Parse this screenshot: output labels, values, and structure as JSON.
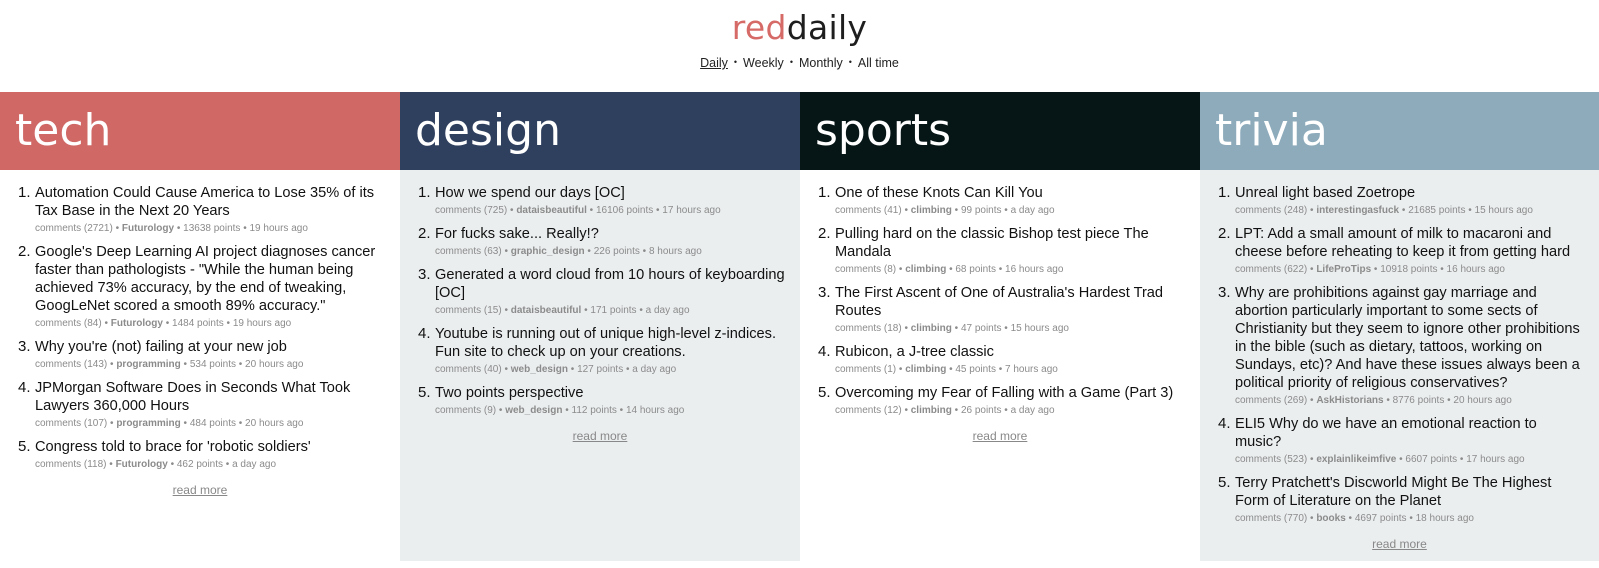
{
  "logo": {
    "part1": "red",
    "part2": "daily"
  },
  "periods": [
    {
      "label": "Daily",
      "active": true
    },
    {
      "label": "Weekly",
      "active": false
    },
    {
      "label": "Monthly",
      "active": false
    },
    {
      "label": "All time",
      "active": false
    }
  ],
  "separator": "•",
  "read_more": "read more",
  "columns": [
    {
      "name": "tech",
      "head_color": "#d06866",
      "body_color": "#ffffff",
      "items": [
        {
          "n": "1.",
          "title": "Automation Could Cause America to Lose 35% of its Tax Base in the Next 20 Years",
          "comments": "comments (2721)",
          "sub": "Futurology",
          "points": "13638 points",
          "time": "19 hours ago"
        },
        {
          "n": "2.",
          "title": "Google's Deep Learning AI project diagnoses cancer faster than pathologists - \"While the human being achieved 73% accuracy, by the end of tweaking, GoogLeNet scored a smooth 89% accuracy.\"",
          "comments": "comments (84)",
          "sub": "Futurology",
          "points": "1484 points",
          "time": "19 hours ago"
        },
        {
          "n": "3.",
          "title": "Why you're (not) failing at your new job",
          "comments": "comments (143)",
          "sub": "programming",
          "points": "534 points",
          "time": "20 hours ago"
        },
        {
          "n": "4.",
          "title": "JPMorgan Software Does in Seconds What Took Lawyers 360,000 Hours",
          "comments": "comments (107)",
          "sub": "programming",
          "points": "484 points",
          "time": "20 hours ago"
        },
        {
          "n": "5.",
          "title": "Congress told to brace for 'robotic soldiers'",
          "comments": "comments (118)",
          "sub": "Futurology",
          "points": "462 points",
          "time": "a day ago"
        }
      ]
    },
    {
      "name": "design",
      "head_color": "#2f3f5e",
      "body_color": "#ebeeef",
      "items": [
        {
          "n": "1.",
          "title": "How we spend our days [OC]",
          "comments": "comments (725)",
          "sub": "dataisbeautiful",
          "points": "16106 points",
          "time": "17 hours ago"
        },
        {
          "n": "2.",
          "title": "For fucks sake... Really!?",
          "comments": "comments (63)",
          "sub": "graphic_design",
          "points": "226 points",
          "time": "8 hours ago"
        },
        {
          "n": "3.",
          "title": "Generated a word cloud from 10 hours of keyboarding [OC]",
          "comments": "comments (15)",
          "sub": "dataisbeautiful",
          "points": "171 points",
          "time": "a day ago"
        },
        {
          "n": "4.",
          "title": "Youtube is running out of unique high-level z-indices. Fun site to check up on your creations.",
          "comments": "comments (40)",
          "sub": "web_design",
          "points": "127 points",
          "time": "a day ago"
        },
        {
          "n": "5.",
          "title": "Two points perspective",
          "comments": "comments (9)",
          "sub": "web_design",
          "points": "112 points",
          "time": "14 hours ago"
        }
      ]
    },
    {
      "name": "sports",
      "head_color": "#061516",
      "body_color": "#ffffff",
      "items": [
        {
          "n": "1.",
          "title": "One of these Knots Can Kill You",
          "comments": "comments (41)",
          "sub": "climbing",
          "points": "99 points",
          "time": "a day ago"
        },
        {
          "n": "2.",
          "title": "Pulling hard on the classic Bishop test piece The Mandala",
          "comments": "comments (8)",
          "sub": "climbing",
          "points": "68 points",
          "time": "16 hours ago"
        },
        {
          "n": "3.",
          "title": "The First Ascent of One of Australia's Hardest Trad Routes",
          "comments": "comments (18)",
          "sub": "climbing",
          "points": "47 points",
          "time": "15 hours ago"
        },
        {
          "n": "4.",
          "title": "Rubicon, a J-tree classic",
          "comments": "comments (1)",
          "sub": "climbing",
          "points": "45 points",
          "time": "7 hours ago"
        },
        {
          "n": "5.",
          "title": "Overcoming my Fear of Falling with a Game (Part 3)",
          "comments": "comments (12)",
          "sub": "climbing",
          "points": "26 points",
          "time": "a day ago"
        }
      ]
    },
    {
      "name": "trivia",
      "head_color": "#8dabbb",
      "body_color": "#ebeeef",
      "items": [
        {
          "n": "1.",
          "title": "Unreal light based Zoetrope",
          "comments": "comments (248)",
          "sub": "interestingasfuck",
          "points": "21685 points",
          "time": "15 hours ago"
        },
        {
          "n": "2.",
          "title": "LPT: Add a small amount of milk to macaroni and cheese before reheating to keep it from getting hard",
          "comments": "comments (622)",
          "sub": "LifeProTips",
          "points": "10918 points",
          "time": "16 hours ago"
        },
        {
          "n": "3.",
          "title": "Why are prohibitions against gay marriage and abortion particularly important to some sects of Christianity but they seem to ignore other prohibitions in the bible (such as dietary, tattoos, working on Sundays, etc)? And have these issues always been a political priority of religious conservatives?",
          "comments": "comments (269)",
          "sub": "AskHistorians",
          "points": "8776 points",
          "time": "20 hours ago"
        },
        {
          "n": "4.",
          "title": "ELI5 Why do we have an emotional reaction to music?",
          "comments": "comments (523)",
          "sub": "explainlikeimfive",
          "points": "6607 points",
          "time": "17 hours ago"
        },
        {
          "n": "5.",
          "title": "Terry Pratchett's Discworld Might Be The Highest Form of Literature on the Planet",
          "comments": "comments (770)",
          "sub": "books",
          "points": "4697 points",
          "time": "18 hours ago"
        }
      ]
    }
  ]
}
